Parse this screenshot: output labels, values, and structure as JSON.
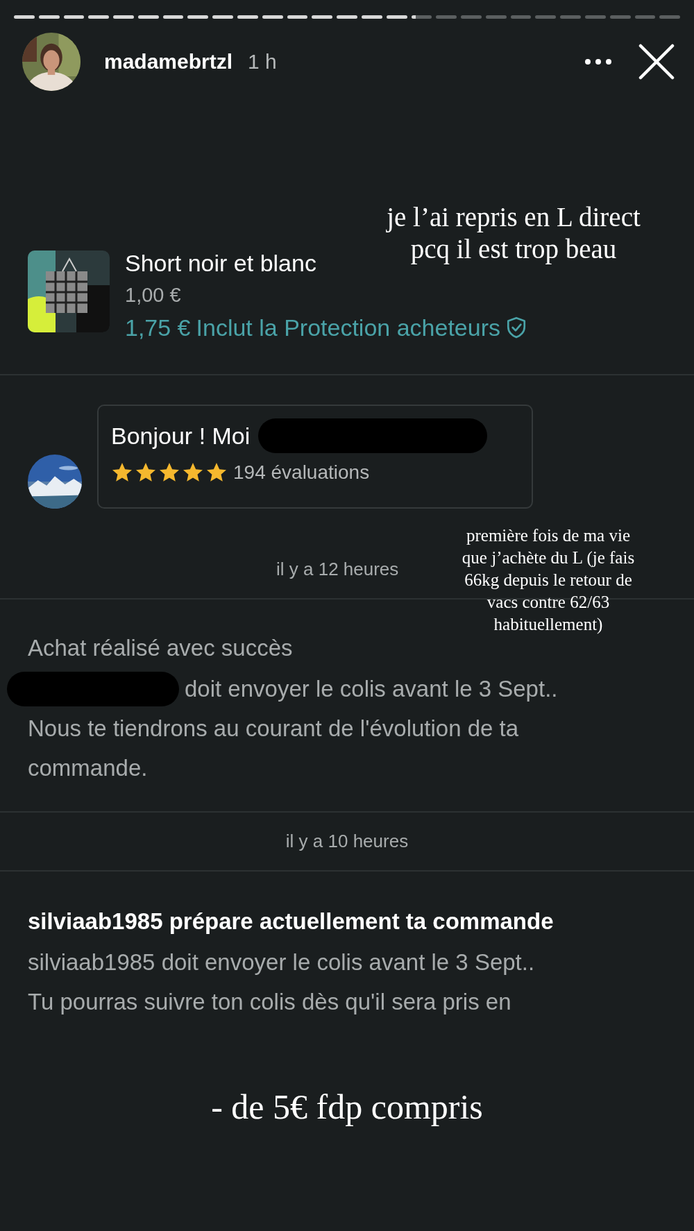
{
  "story": {
    "progress": [
      {
        "kind": "viewed"
      },
      {
        "kind": "viewed"
      },
      {
        "kind": "viewed"
      },
      {
        "kind": "viewed"
      },
      {
        "kind": "viewed"
      },
      {
        "kind": "viewed"
      },
      {
        "kind": "viewed"
      },
      {
        "kind": "viewed"
      },
      {
        "kind": "viewed"
      },
      {
        "kind": "viewed"
      },
      {
        "kind": "viewed"
      },
      {
        "kind": "viewed"
      },
      {
        "kind": "viewed"
      },
      {
        "kind": "viewed"
      },
      {
        "kind": "viewed"
      },
      {
        "kind": "viewed"
      },
      {
        "kind": "current"
      },
      {
        "kind": "upcoming"
      },
      {
        "kind": "upcoming"
      },
      {
        "kind": "upcoming"
      },
      {
        "kind": "upcoming"
      },
      {
        "kind": "upcoming"
      },
      {
        "kind": "upcoming"
      },
      {
        "kind": "upcoming"
      },
      {
        "kind": "upcoming"
      },
      {
        "kind": "upcoming"
      },
      {
        "kind": "upcoming"
      }
    ],
    "username": "madamebrtzl",
    "time": "1 h"
  },
  "item": {
    "title": "Short noir et blanc",
    "price": "1,00 €",
    "total": "1,75 €",
    "protection": "Inclut la Protection acheteurs"
  },
  "message": {
    "text": "Bonjour ! Moi",
    "stars": 5,
    "reviews": "194 évaluations"
  },
  "timestamps": [
    "il y a 12 heures",
    "il y a 10 heures"
  ],
  "updates": [
    {
      "title": "Achat réalisé avec succès",
      "emphasis": false,
      "redacted": true,
      "lead": "doit envoyer le colis avant le 3 Sept..",
      "body": "Nous te tiendrons au courant de l'évolution de ta\ncommande."
    },
    {
      "title": "silviaab1985 prépare actuellement ta commande",
      "emphasis": true,
      "redacted": false,
      "lead": "silviaab1985 doit envoyer le colis avant le 3 Sept..",
      "body": "Tu pourras suivre ton colis dès qu'il sera pris en"
    }
  ],
  "stickers": [
    {
      "text": "je l’ai repris en L direct\npcq il est trop beau"
    },
    {
      "text": "première fois de ma vie\nque j’achète du L (je fais\n66kg depuis le retour de\nvacs contre 62/63\nhabituellement)"
    },
    {
      "text": "- de 5€ fdp compris"
    }
  ]
}
